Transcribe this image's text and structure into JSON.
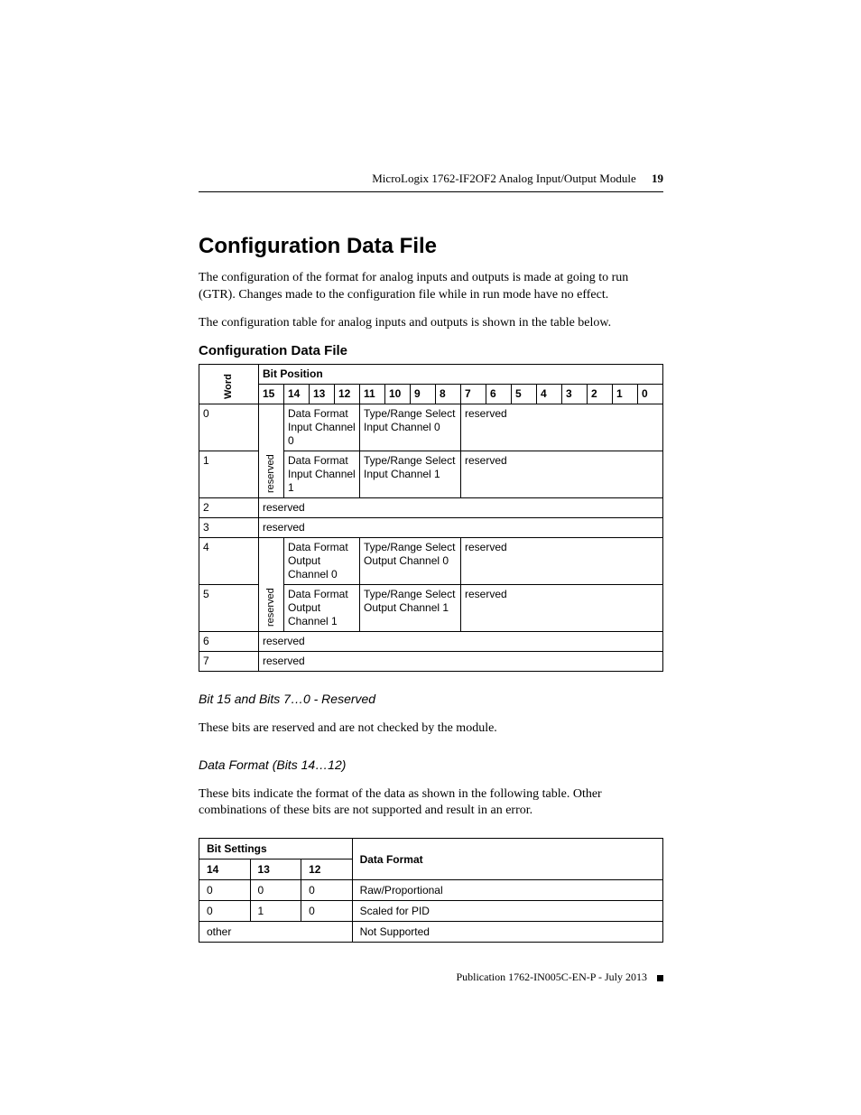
{
  "header": {
    "title": "MicroLogix 1762-IF2OF2 Analog Input/Output Module",
    "page_number": "19"
  },
  "main": {
    "h1": "Configuration Data File",
    "p1": "The configuration of the format for analog inputs and outputs is made at going to run (GTR). Changes made to the configuration file while in run mode have no effect.",
    "p2": "The configuration table for analog inputs and outputs is shown in the table below.",
    "h2": "Configuration Data File"
  },
  "cfg_table": {
    "word_label": "Word",
    "bit_position_label": "Bit Position",
    "bits": [
      "15",
      "14",
      "13",
      "12",
      "11",
      "10",
      "9",
      "8",
      "7",
      "6",
      "5",
      "4",
      "3",
      "2",
      "1",
      "0"
    ],
    "rows": {
      "r0": {
        "word": "0",
        "col15": "reserved",
        "c1": "Data Format Input Channel 0",
        "c2": "Type/Range Select Input Channel 0",
        "c3": "reserved"
      },
      "r1": {
        "word": "1",
        "c1": "Data Format Input Channel 1",
        "c2": "Type/Range Select Input Channel 1",
        "c3": "reserved"
      },
      "r2": {
        "word": "2",
        "c": "reserved"
      },
      "r3": {
        "word": "3",
        "c": "reserved"
      },
      "r4": {
        "word": "4",
        "col15": "reserved",
        "c1": "Data Format Output Channel 0",
        "c2": "Type/Range Select Output Channel 0",
        "c3": "reserved"
      },
      "r5": {
        "word": "5",
        "c1": "Data Format Output Channel 1",
        "c2": "Type/Range Select Output Channel 1",
        "c3": "reserved"
      },
      "r6": {
        "word": "6",
        "c": "reserved"
      },
      "r7": {
        "word": "7",
        "c": "reserved"
      }
    }
  },
  "sections": {
    "s1_title": "Bit 15 and Bits 7…0 - Reserved",
    "s1_body": "These bits are reserved and are not checked by the module.",
    "s2_title": "Data Format (Bits 14…12)",
    "s2_body": "These bits indicate the format of the data as shown in the following table. Other combinations of these bits are not supported and result in an error."
  },
  "fmt_table": {
    "head": {
      "bit_settings": "Bit Settings",
      "data_format": "Data Format",
      "b14": "14",
      "b13": "13",
      "b12": "12"
    },
    "rows": [
      {
        "b14": "0",
        "b13": "0",
        "b12": "0",
        "fmt": "Raw/Proportional"
      },
      {
        "b14": "0",
        "b13": "1",
        "b12": "0",
        "fmt": "Scaled for PID"
      }
    ],
    "other": {
      "label": "other",
      "fmt": "Not Supported"
    }
  },
  "footer": {
    "text": "Publication 1762-IN005C-EN-P - July 2013"
  }
}
